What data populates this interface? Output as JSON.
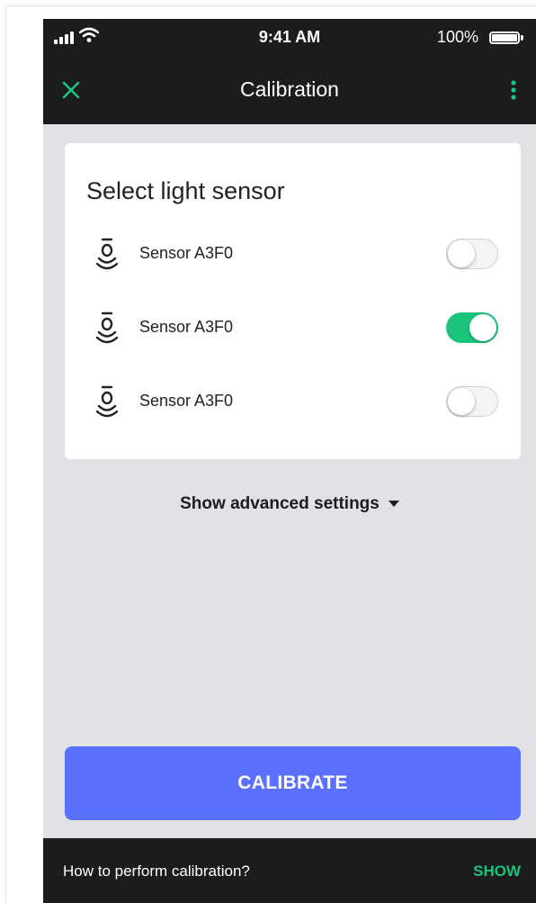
{
  "status_bar": {
    "time": "9:41 AM",
    "battery_percent": "100%"
  },
  "app_bar": {
    "title": "Calibration",
    "close_icon": "close-icon",
    "menu_icon": "more-vertical-icon"
  },
  "sensor_card": {
    "title": "Select light sensor",
    "sensors": [
      {
        "label": "Sensor A3F0",
        "enabled": false,
        "icon": "light-sensor-icon"
      },
      {
        "label": "Sensor A3F0",
        "enabled": true,
        "icon": "light-sensor-icon"
      },
      {
        "label": "Sensor A3F0",
        "enabled": false,
        "icon": "light-sensor-icon"
      }
    ]
  },
  "advanced_settings": {
    "label": "Show advanced settings",
    "icon": "caret-down-icon"
  },
  "calibrate_button": {
    "label": "CALIBRATE"
  },
  "snackbar": {
    "message": "How to perform calibration?",
    "action": "SHOW"
  },
  "colors": {
    "accent_green": "#1bc47d",
    "primary_blue": "#5b70ff",
    "bar_dark": "#1c1c1e",
    "background": "#e1e1e6"
  }
}
